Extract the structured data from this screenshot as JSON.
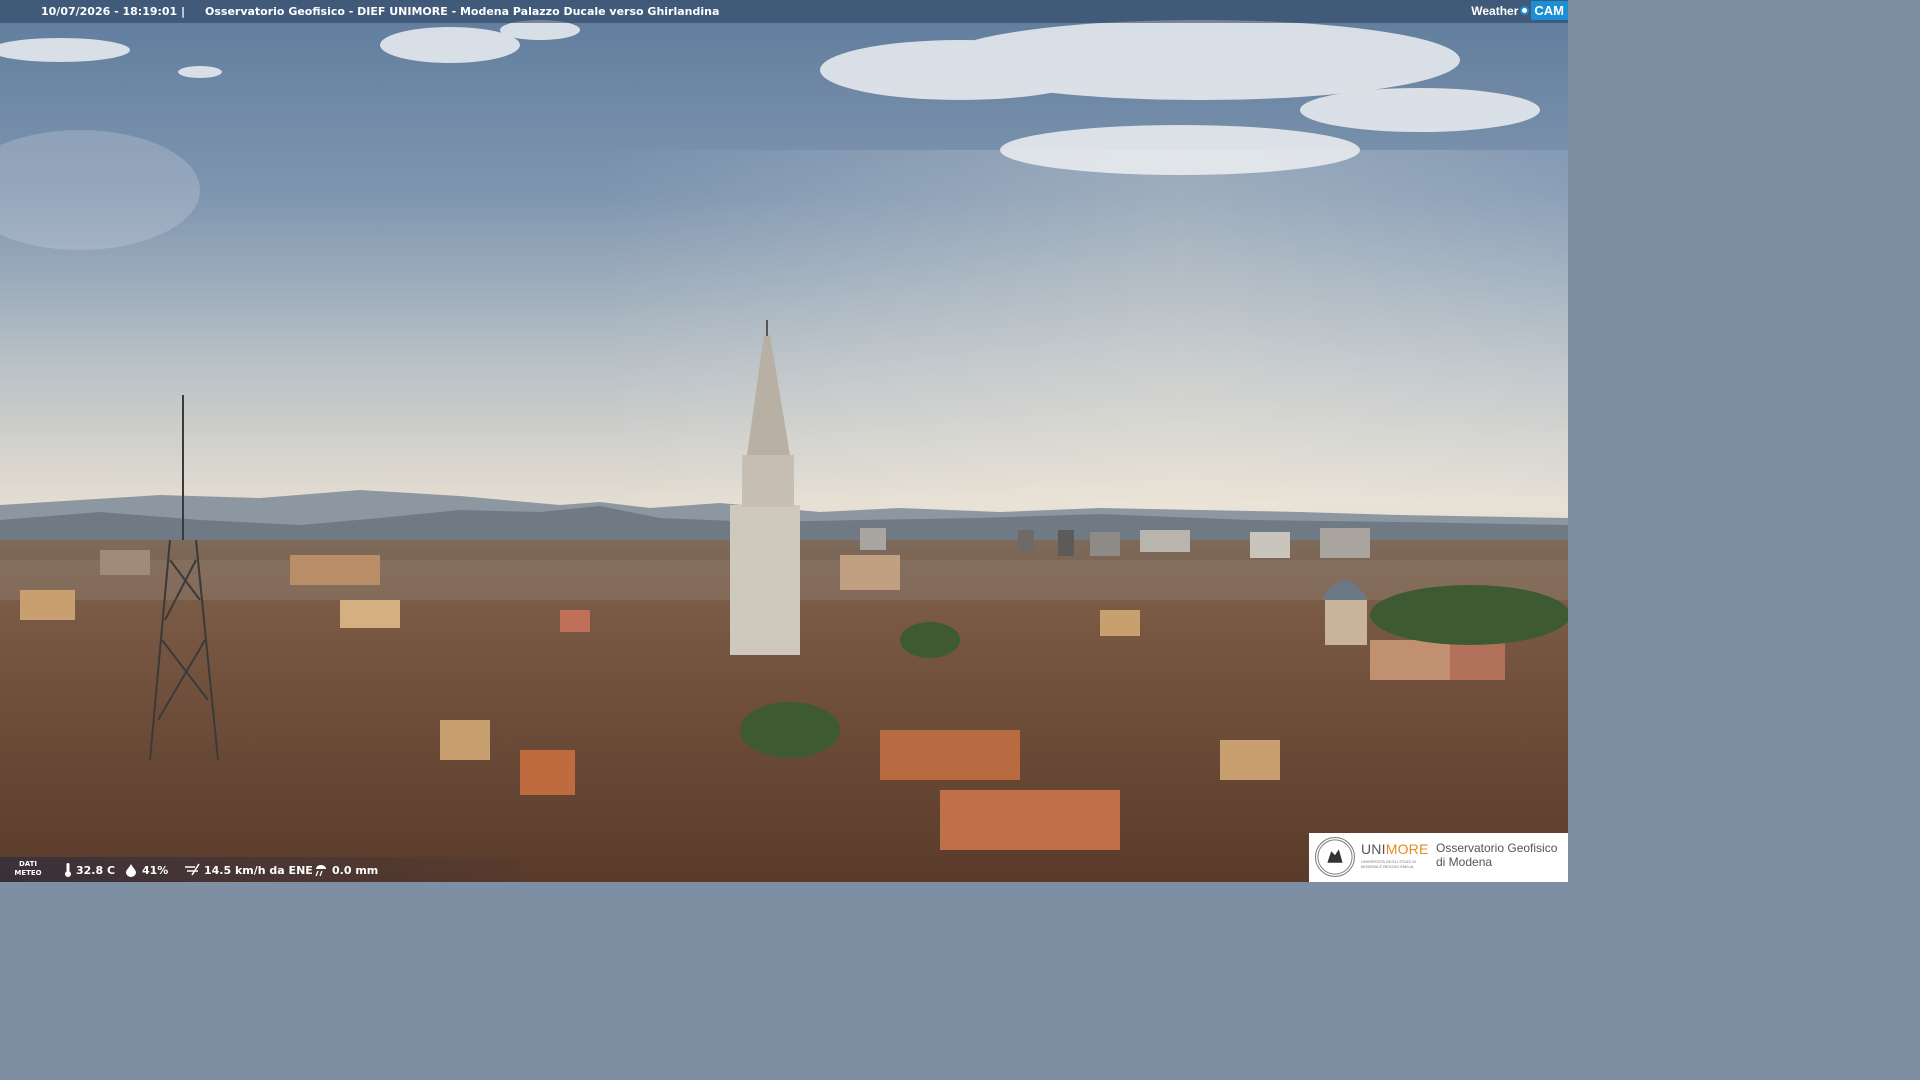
{
  "header": {
    "timestamp": "10/07/2026 - 18:19:01",
    "separator": "|",
    "title": "Osservatorio Geofisico - DIEF UNIMORE - Modena Palazzo Ducale verso Ghirlandina"
  },
  "brand_logo": {
    "weather": "Weather",
    "cam": "CAM"
  },
  "meteo": {
    "label_line1": "DATI",
    "label_line2": "METEO",
    "temperature": "32.8 C",
    "humidity": "41%",
    "wind": "14.5 km/h da ENE",
    "rain": "0.0 mm"
  },
  "institution": {
    "brand_uni": "UNI",
    "brand_more": "MORE",
    "brand_sub": "UNIVERSITÀ DEGLI STUDI DI MODENA E REGGIO EMILIA",
    "name_line1": "Osservatorio Geofisico",
    "name_line2": "di Modena"
  },
  "icons": {
    "temperature": "thermometer-icon",
    "humidity": "droplet-icon",
    "wind": "wind-icon",
    "rain": "rain-icon"
  },
  "colors": {
    "sky_top": "#6b85a3",
    "sky_horizon": "#e6dfd3",
    "roofs": "#7a5038",
    "accent_blue": "#1a8fd6",
    "accent_orange": "#e58b1f"
  }
}
